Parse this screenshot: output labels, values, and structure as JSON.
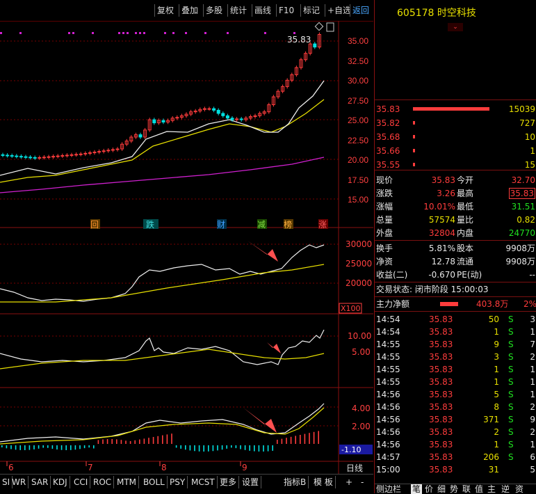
{
  "toolbar": {
    "buttons": [
      "复权",
      "叠加",
      "多股",
      "统计",
      "画线",
      "F10",
      "标记",
      "+自选",
      "返回"
    ]
  },
  "stock": {
    "code": "605178",
    "name": "时空科技"
  },
  "main_chart": {
    "price_ticks": [
      "35.00",
      "32.50",
      "30.00",
      "27.50",
      "25.00",
      "22.50",
      "20.00",
      "17.50",
      "15.00"
    ],
    "high_label": "35.83",
    "markers": [
      "回",
      "跌",
      "财",
      "减",
      "榜",
      "涨"
    ]
  },
  "vol_panel": {
    "ticks": [
      "30000",
      "25000",
      "20000"
    ],
    "unit": "X100"
  },
  "panel2": {
    "ticks": [
      "10.00",
      "5.00"
    ]
  },
  "macd_panel": {
    "ticks": [
      "4.00",
      "2.00"
    ],
    "value": "-1.10"
  },
  "x_axis": {
    "labels": [
      "6",
      "7",
      "8",
      "9"
    ],
    "period": "日线"
  },
  "bottom_tabs": [
    "SI",
    "WR",
    "SAR",
    "KDJ",
    "CCI",
    "ROC",
    "MTM",
    "BOLL",
    "PSY",
    "MCST",
    "更多",
    "设置",
    "指标B",
    "模 板",
    "+",
    "-"
  ],
  "order_book": [
    {
      "price": "35.83",
      "vol": "15039"
    },
    {
      "price": "35.82",
      "vol": "727"
    },
    {
      "price": "35.68",
      "vol": "10"
    },
    {
      "price": "35.66",
      "vol": "1"
    },
    {
      "price": "35.55",
      "vol": "15"
    }
  ],
  "quote": {
    "rows": [
      {
        "l1": "现价",
        "v1": "35.83",
        "l2": "今开",
        "v2": "32.70"
      },
      {
        "l1": "涨跌",
        "v1": "3.26",
        "l2": "最高",
        "v2": "35.83"
      },
      {
        "l1": "涨幅",
        "v1": "10.01%",
        "l2": "最低",
        "v2": "31.51"
      },
      {
        "l1": "总量",
        "v1": "57574",
        "l2": "量比",
        "v2": "0.82"
      },
      {
        "l1": "外盘",
        "v1": "32804",
        "l2": "内盘",
        "v2": "24770"
      }
    ],
    "rows2": [
      {
        "l1": "换手",
        "v1": "5.81%",
        "l2": "股本",
        "v2": "9908万"
      },
      {
        "l1": "净资",
        "v1": "12.78",
        "l2": "流通",
        "v2": "9908万"
      },
      {
        "l1": "收益(二)",
        "v1": "-0.670",
        "l2": "PE(动)",
        "v2": "--"
      }
    ],
    "status": "交易状态: 闭市阶段 15:00:03",
    "netflow_label": "主力净额",
    "netflow_value": "403.8万",
    "netflow_pct": "2%"
  },
  "ticks": [
    {
      "t": "14:54",
      "p": "35.83",
      "v": "50",
      "s": "S",
      "n": "3"
    },
    {
      "t": "14:54",
      "p": "35.83",
      "v": "1",
      "s": "S",
      "n": "1"
    },
    {
      "t": "14:55",
      "p": "35.83",
      "v": "9",
      "s": "S",
      "n": "7"
    },
    {
      "t": "14:55",
      "p": "35.83",
      "v": "3",
      "s": "S",
      "n": "2"
    },
    {
      "t": "14:55",
      "p": "35.83",
      "v": "1",
      "s": "S",
      "n": "1"
    },
    {
      "t": "14:55",
      "p": "35.83",
      "v": "1",
      "s": "S",
      "n": "1"
    },
    {
      "t": "14:56",
      "p": "35.83",
      "v": "5",
      "s": "S",
      "n": "1"
    },
    {
      "t": "14:56",
      "p": "35.83",
      "v": "8",
      "s": "S",
      "n": "2"
    },
    {
      "t": "14:56",
      "p": "35.83",
      "v": "371",
      "s": "S",
      "n": "9"
    },
    {
      "t": "14:56",
      "p": "35.83",
      "v": "2",
      "s": "S",
      "n": "2"
    },
    {
      "t": "14:56",
      "p": "35.83",
      "v": "1",
      "s": "S",
      "n": "1"
    },
    {
      "t": "14:57",
      "p": "35.83",
      "v": "206",
      "s": "S",
      "n": "6"
    },
    {
      "t": "15:00",
      "p": "35.83",
      "v": "31",
      "s": "",
      "n": "5"
    }
  ],
  "right_tabs": [
    "侧边栏",
    "笔",
    "价",
    "细",
    "势",
    "联",
    "值",
    "主",
    "逆",
    "资"
  ]
}
